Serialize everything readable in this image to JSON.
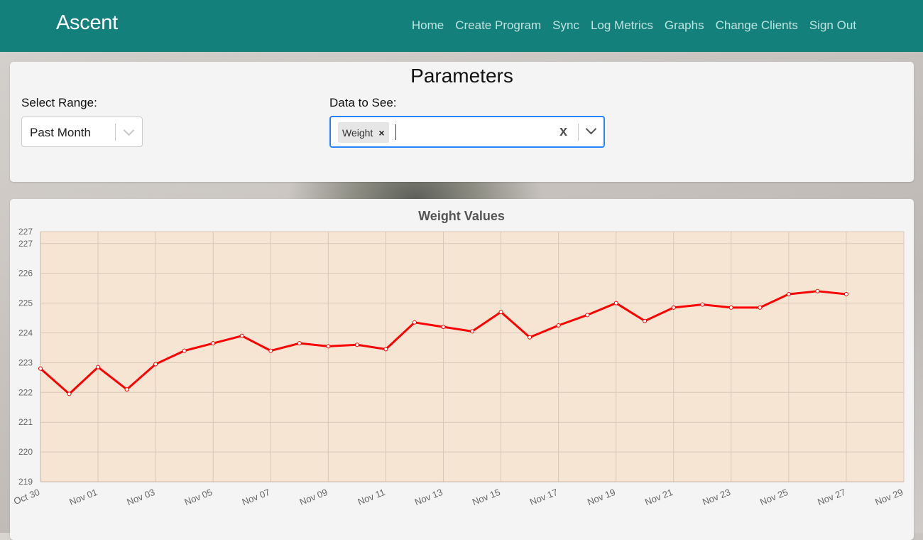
{
  "nav": {
    "brand": "Ascent",
    "links": [
      "Home",
      "Create Program",
      "Sync",
      "Log Metrics",
      "Graphs",
      "Change Clients",
      "Sign Out"
    ]
  },
  "parameters": {
    "title": "Parameters",
    "range_label": "Select Range:",
    "range_value": "Past Month",
    "data_label": "Data to See:",
    "selected_data": [
      "Weight"
    ],
    "chip_remove": "×",
    "clear": "x"
  },
  "colors": {
    "navbar": "#13807c",
    "plot_bg": "#f7e5d4",
    "line": "#ff0000",
    "focus_border": "#2684ff"
  },
  "chart_data": {
    "type": "line",
    "title": "Weight Values",
    "xlabel": "",
    "ylabel": "",
    "x_tick_labels": [
      "Oct 30",
      "Nov 01",
      "Nov 03",
      "Nov 05",
      "Nov 07",
      "Nov 09",
      "Nov 11",
      "Nov 13",
      "Nov 15",
      "Nov 17",
      "Nov 19",
      "Nov 21",
      "Nov 23",
      "Nov 25",
      "Nov 27",
      "Nov 29"
    ],
    "y_tick_labels": [
      "227",
      "227",
      "226",
      "225",
      "224",
      "223",
      "222",
      "221",
      "220",
      "219"
    ],
    "ylim": [
      219,
      227.4
    ],
    "grid": true,
    "series": [
      {
        "x": [
          "Oct 30",
          "Oct 31",
          "Nov 01",
          "Nov 02",
          "Nov 03",
          "Nov 04",
          "Nov 05",
          "Nov 06",
          "Nov 07",
          "Nov 08",
          "Nov 09",
          "Nov 10",
          "Nov 11",
          "Nov 12",
          "Nov 13",
          "Nov 14",
          "Nov 15",
          "Nov 16",
          "Nov 17",
          "Nov 18",
          "Nov 19",
          "Nov 20",
          "Nov 21",
          "Nov 22",
          "Nov 23",
          "Nov 24",
          "Nov 25",
          "Nov 26",
          "Nov 27"
        ],
        "values": [
          222.8,
          221.95,
          222.85,
          222.1,
          222.95,
          223.4,
          223.65,
          223.9,
          223.4,
          223.65,
          223.55,
          223.6,
          223.45,
          224.35,
          224.2,
          224.05,
          224.7,
          223.85,
          224.25,
          224.6,
          225.0,
          224.4,
          224.85,
          224.95,
          224.85,
          224.85,
          225.3,
          225.4,
          225.3
        ]
      }
    ]
  }
}
